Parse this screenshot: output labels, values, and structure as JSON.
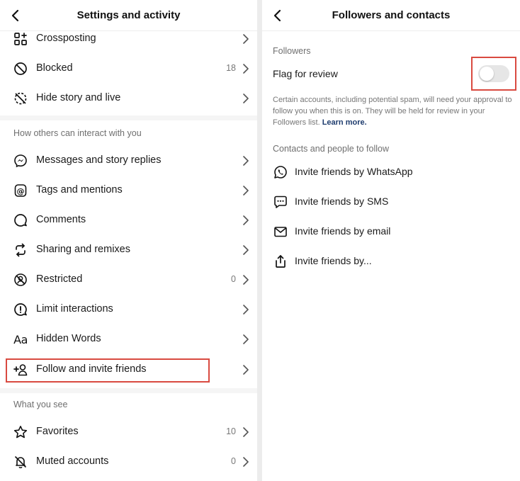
{
  "left": {
    "title": "Settings and activity",
    "items_top": [
      {
        "label": "Crossposting",
        "count": ""
      },
      {
        "label": "Blocked",
        "count": "18"
      },
      {
        "label": "Hide story and live",
        "count": ""
      }
    ],
    "section_interact": "How others can interact with you",
    "items_interact": [
      {
        "label": "Messages and story replies",
        "count": ""
      },
      {
        "label": "Tags and mentions",
        "count": ""
      },
      {
        "label": "Comments",
        "count": ""
      },
      {
        "label": "Sharing and remixes",
        "count": ""
      },
      {
        "label": "Restricted",
        "count": "0"
      },
      {
        "label": "Limit interactions",
        "count": ""
      },
      {
        "label": "Hidden Words",
        "count": ""
      },
      {
        "label": "Follow and invite friends",
        "count": ""
      }
    ],
    "section_see": "What you see",
    "items_see": [
      {
        "label": "Favorites",
        "count": "10"
      },
      {
        "label": "Muted accounts",
        "count": "0"
      }
    ],
    "hidden_words_icon_text": "Aa"
  },
  "right": {
    "title": "Followers and contacts",
    "section_followers": "Followers",
    "flag_label": "Flag for review",
    "flag_on": false,
    "description": "Certain accounts, including potential spam, will need your approval to follow you when this is on. They will be held for review in your Followers list.",
    "learn_more": "Learn more.",
    "section_contacts": "Contacts and people to follow",
    "invite_items": [
      {
        "label": "Invite friends by WhatsApp",
        "icon": "whatsapp-icon"
      },
      {
        "label": "Invite friends by SMS",
        "icon": "sms-icon"
      },
      {
        "label": "Invite friends by email",
        "icon": "email-icon"
      },
      {
        "label": "Invite friends by...",
        "icon": "share-icon"
      }
    ]
  },
  "colors": {
    "highlight": "#d94a40",
    "toggle_off": "#e6e6e6",
    "link": "#1e3c6e"
  }
}
